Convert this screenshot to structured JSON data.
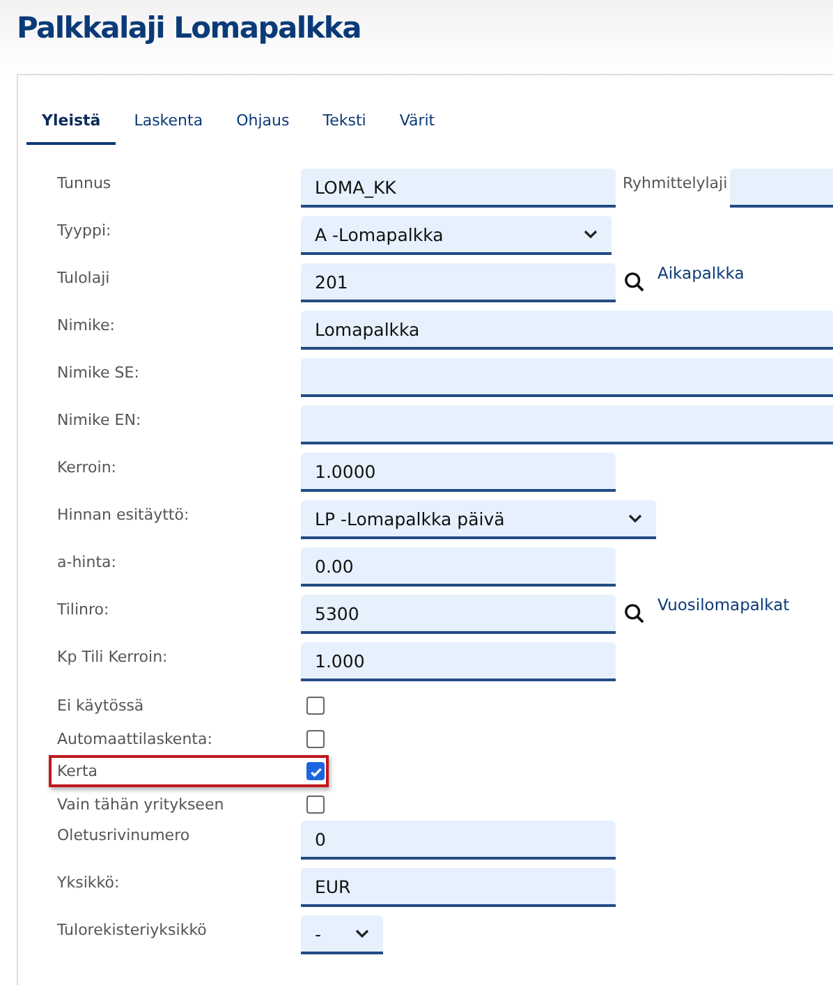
{
  "title": "Palkkalaji Lomapalkka",
  "tabs": [
    {
      "label": "Yleistä",
      "selected": true
    },
    {
      "label": "Laskenta",
      "selected": false
    },
    {
      "label": "Ohjaus",
      "selected": false
    },
    {
      "label": "Teksti",
      "selected": false
    },
    {
      "label": "Värit",
      "selected": false
    }
  ],
  "fields": [
    {
      "label": "Tunnus",
      "kind": "text",
      "value": "LOMA_KK",
      "side": {
        "label": "Ryhmittelylaji"
      }
    },
    {
      "label": "Tyyppi:",
      "kind": "select",
      "value": "A -Lomapalkka"
    },
    {
      "label": "Tulolaji",
      "kind": "text",
      "value": "201",
      "lookup": {
        "link": "Aikapalkka"
      }
    },
    {
      "label": "Nimike:",
      "kind": "wide_text",
      "value": "Lomapalkka"
    },
    {
      "label": "Nimike SE:",
      "kind": "wide_text"
    },
    {
      "label": "Nimike EN:",
      "kind": "wide_text"
    },
    {
      "label": "Kerroin:",
      "kind": "text",
      "value": "1.0000"
    },
    {
      "label": "Hinnan esitäyttö:",
      "kind": "wide_select",
      "value": "LP -Lomapalkka päivä"
    },
    {
      "label": "a-hinta:",
      "kind": "text",
      "value": "0.00"
    },
    {
      "label": "Tilinro:",
      "kind": "text",
      "value": "5300",
      "lookup": {
        "link": "Vuosilomapalkat"
      }
    },
    {
      "label": "Kp Tili Kerroin:",
      "kind": "text",
      "value": "1.000"
    },
    {
      "label": "Ei käytössä",
      "kind": "checkbox",
      "checked": false,
      "highlighted": false
    },
    {
      "label": "Automaattilaskenta:",
      "kind": "checkbox",
      "checked": false,
      "highlighted": false
    },
    {
      "label": "Kerta",
      "kind": "checkbox",
      "checked": true,
      "highlighted": true
    },
    {
      "label": "Vain tähän yritykseen",
      "kind": "checkbox",
      "checked": false,
      "highlighted": false
    },
    {
      "label": "Oletusrivinumero",
      "kind": "text",
      "value": "0"
    },
    {
      "label": "Yksikkö:",
      "kind": "text",
      "value": "EUR"
    },
    {
      "label": "Tulorekisteriyksikkö",
      "kind": "small_select",
      "value": "-"
    }
  ]
}
